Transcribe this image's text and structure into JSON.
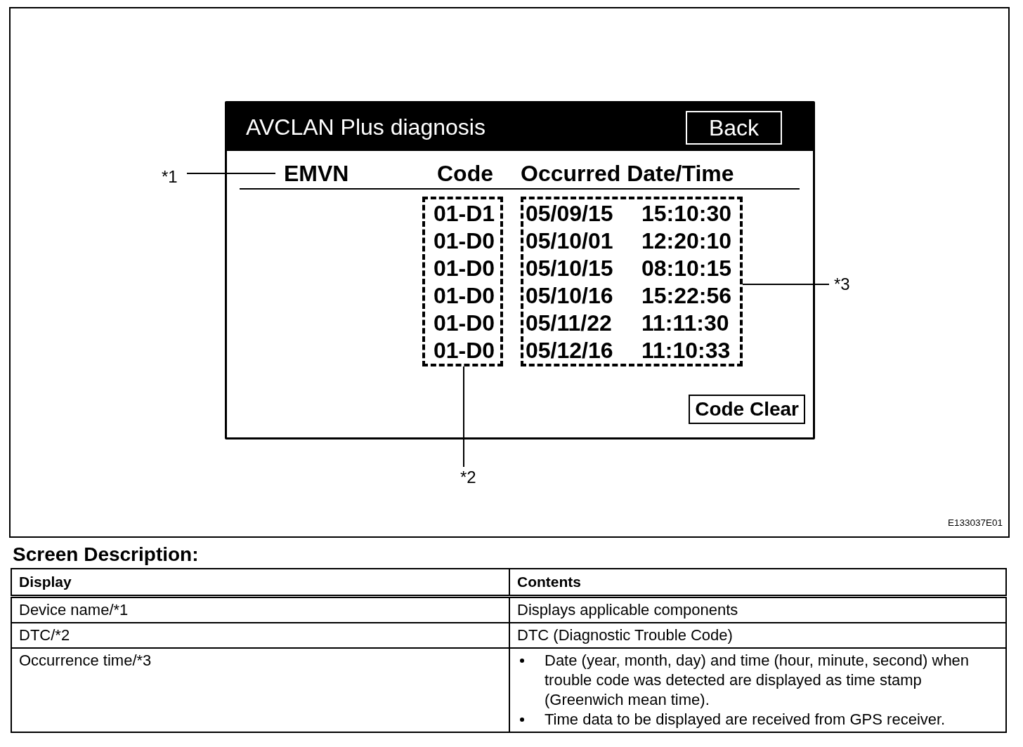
{
  "figure": {
    "screen": {
      "title": "AVCLAN Plus diagnosis",
      "back_button": "Back",
      "columns": [
        "EMVN",
        "Code",
        "Occurred Date/Time"
      ],
      "records": [
        {
          "code": "01-D1",
          "date": "05/09/15",
          "time": "15:10:30"
        },
        {
          "code": "01-D0",
          "date": "05/10/01",
          "time": "12:20:10"
        },
        {
          "code": "01-D0",
          "date": "05/10/15",
          "time": "08:10:15"
        },
        {
          "code": "01-D0",
          "date": "05/10/16",
          "time": "15:22:56"
        },
        {
          "code": "01-D0",
          "date": "05/11/22",
          "time": "11:11:30"
        },
        {
          "code": "01-D0",
          "date": "05/12/16",
          "time": "11:10:33"
        }
      ],
      "code_clear_button": "Code Clear"
    },
    "callouts": [
      "*1",
      "*2",
      "*3"
    ],
    "figure_id": "E133037E01"
  },
  "section_title": "Screen Description:",
  "description_table": {
    "columns": [
      "Display",
      "Contents"
    ],
    "rows": [
      {
        "display": "Device name/*1",
        "contents": {
          "kind": "text",
          "text": "Displays applicable components"
        }
      },
      {
        "display": "DTC/*2",
        "contents": {
          "kind": "text",
          "text": "DTC (Diagnostic Trouble Code)"
        }
      },
      {
        "display": "Occurrence time/*3",
        "contents": {
          "kind": "bullets",
          "items": [
            "Date (year, month, day) and time (hour, minute, second) when trouble code was detected are displayed as time stamp (Greenwich mean time).",
            "Time data to be displayed are received from GPS receiver."
          ]
        }
      }
    ]
  }
}
